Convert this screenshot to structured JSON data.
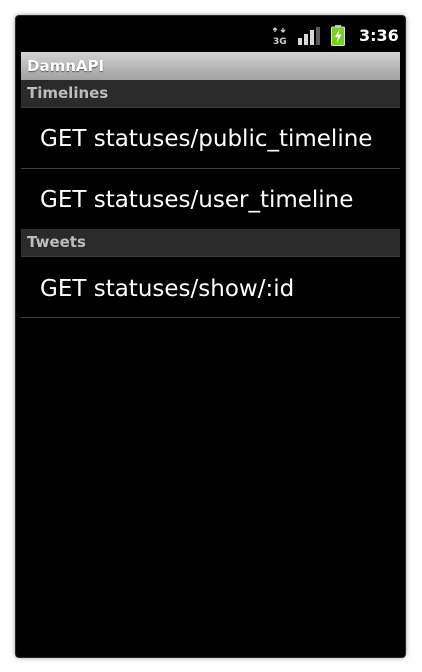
{
  "status_bar": {
    "network_type": "3G",
    "network_icon": "3g-data-icon",
    "signal_icon": "signal-strength-icon",
    "battery_icon": "battery-charging-icon",
    "time": "3:36"
  },
  "app": {
    "title": "DamnAPI"
  },
  "sections": [
    {
      "header": "Timelines",
      "items": [
        {
          "label": "GET statuses/public_timeline"
        },
        {
          "label": "GET statuses/user_timeline"
        }
      ]
    },
    {
      "header": "Tweets",
      "items": [
        {
          "label": "GET statuses/show/:id"
        }
      ]
    }
  ],
  "colors": {
    "background": "#000000",
    "title_bar": "#b6b6b6",
    "section_header": "#2a2a2a",
    "battery_green": "#7bd01c"
  }
}
